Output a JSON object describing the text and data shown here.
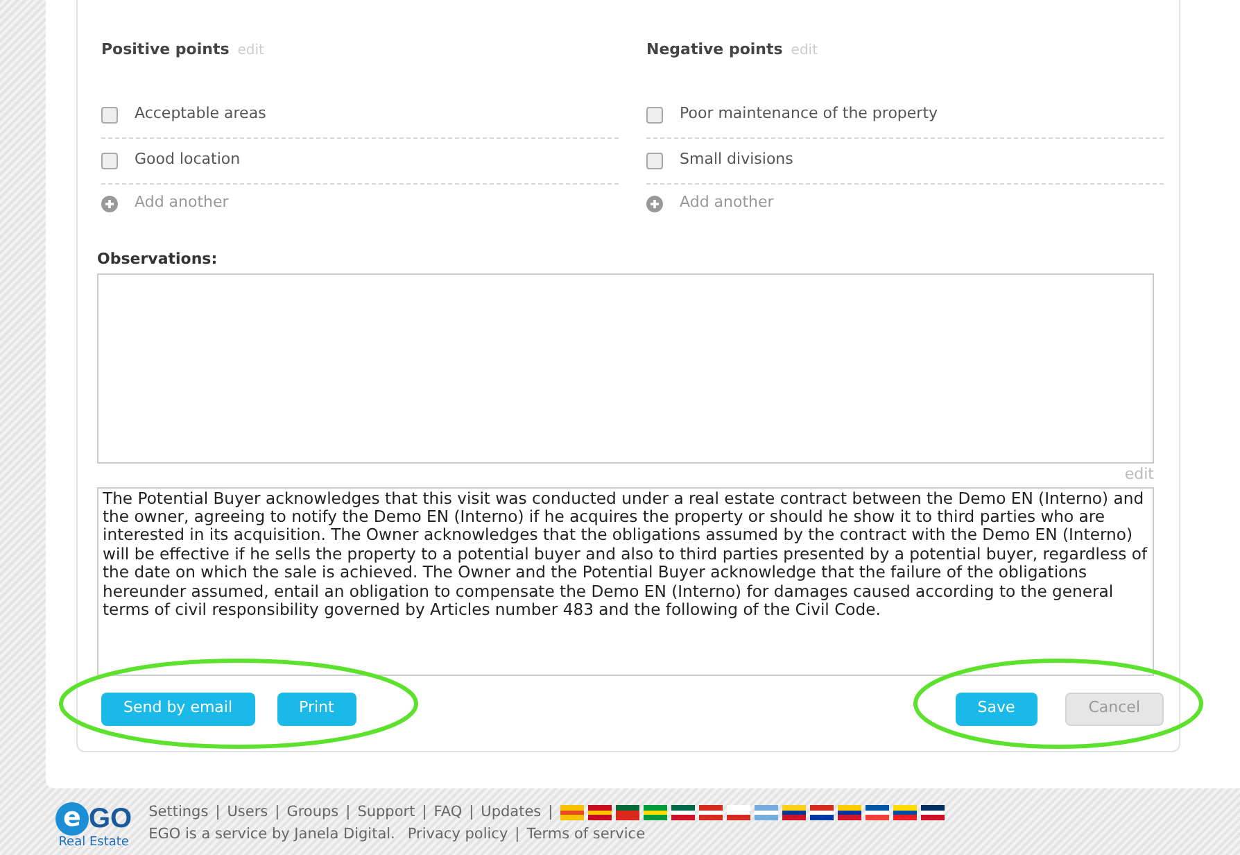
{
  "point_lists": [
    {
      "title": "Positive points",
      "edit": "edit",
      "items": [
        {
          "label": "Acceptable areas",
          "checked": false
        },
        {
          "label": "Good location",
          "checked": false
        }
      ],
      "add": "Add another"
    },
    {
      "title": "Negative points",
      "edit": "edit",
      "items": [
        {
          "label": "Poor maintenance of the property",
          "checked": false
        },
        {
          "label": "Small divisions",
          "checked": false
        }
      ],
      "add": "Add another"
    }
  ],
  "observations": {
    "label": "Observations:"
  },
  "terms": {
    "edit": "edit",
    "text": "The Potential Buyer acknowledges that this visit was conducted under a real estate contract between the Demo EN (Interno) and the owner, agreeing to notify the Demo EN (Interno) if he acquires the property or should he show it to third parties who are interested in its acquisition. The Owner acknowledges that the obligations assumed by the contract with the Demo EN (Interno) will be effective if he sells the property to a potential buyer and also to third parties presented by a potential buyer, regardless of the date on which the sale is achieved. The Owner and the Potential Buyer acknowledge that the failure of the obligations hereunder assumed, entail an obligation to compensate the Demo EN (Interno) for damages caused according to the general terms of civil responsibility governed by Articles number 483 and the following of the Civil Code."
  },
  "left_buttons": [
    {
      "label": "Send by email",
      "disabled": false
    },
    {
      "label": "Print",
      "disabled": false
    }
  ],
  "right_buttons": [
    {
      "label": "Save",
      "disabled": false
    },
    {
      "label": "Cancel",
      "disabled": true
    }
  ],
  "footer": {
    "logo": "GO",
    "logo_letter": "e",
    "tagline": "Real Estate",
    "links": [
      "Settings",
      "Users",
      "Groups",
      "Support",
      "FAQ",
      "Updates"
    ],
    "separator": "|",
    "service_text": "EGO is a service by Janela Digital.",
    "legal_links": [
      "Privacy policy",
      "Terms of service"
    ]
  }
}
